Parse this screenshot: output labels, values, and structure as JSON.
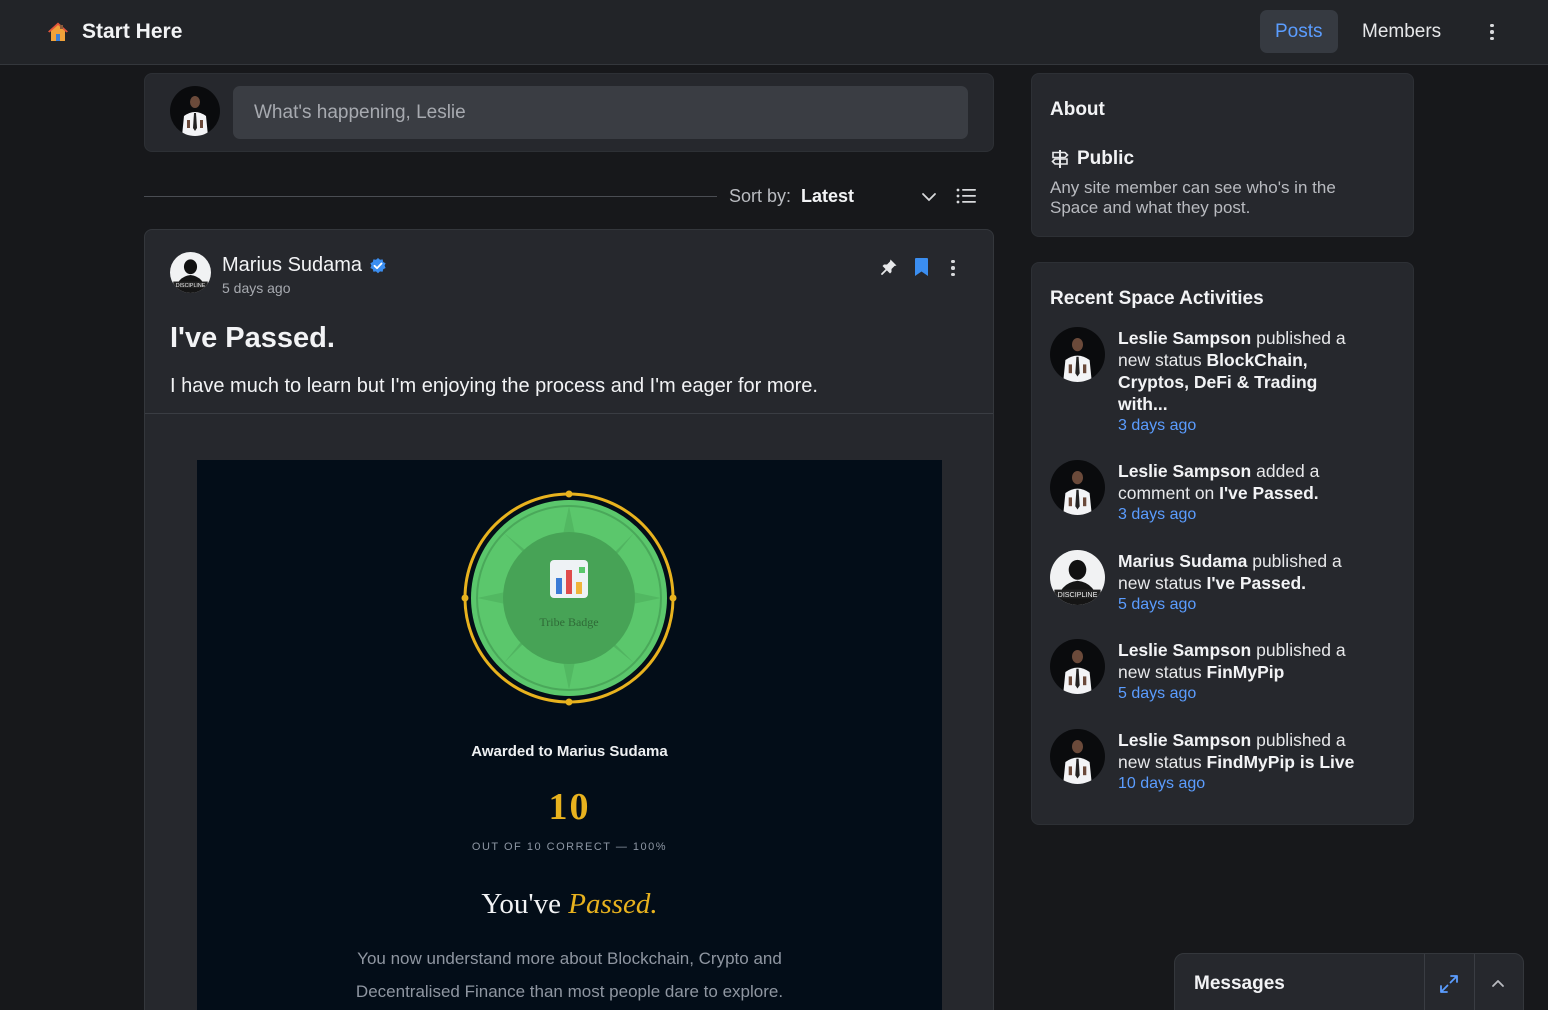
{
  "header": {
    "title": "Start Here",
    "tabs": [
      {
        "label": "Posts",
        "active": true
      },
      {
        "label": "Members",
        "active": false
      }
    ],
    "icons": {
      "brand": "house-icon",
      "menu": "more-vertical-icon"
    }
  },
  "composer": {
    "placeholder": "What's happening, Leslie"
  },
  "sort": {
    "label": "Sort by:",
    "value": "Latest"
  },
  "post": {
    "author": "Marius Sudama",
    "verified": true,
    "time": "5 days ago",
    "title": "I've Passed.",
    "body": "I have much to learn but I'm enjoying the process and I'm eager for more.",
    "certificate": {
      "badge_label": "Tribe Badge",
      "awarded": "Awarded to Marius Sudama",
      "score": "10",
      "score_sub": "OUT OF 10 CORRECT — 100%",
      "passed_prefix": "You've",
      "passed_word": "Passed.",
      "description_line1": "You now understand more about Blockchain, Crypto and",
      "description_line2": "Decentralised Finance than most people dare to explore."
    }
  },
  "about": {
    "title": "About",
    "visibility": "Public",
    "description": "Any site member can see who's in the Space and what they post."
  },
  "activities": {
    "title": "Recent Space Activities",
    "items": [
      {
        "actor": "Leslie Sampson",
        "action": " published a new status ",
        "target": "BlockChain, Cryptos, DeFi & Trading with...",
        "time": "3 days ago"
      },
      {
        "actor": "Leslie Sampson",
        "action": " added a comment on ",
        "target": "I've Passed.",
        "time": "3 days ago"
      },
      {
        "actor": "Marius Sudama",
        "action": " published a new status ",
        "target": "I've Passed.",
        "time": "5 days ago"
      },
      {
        "actor": "Leslie Sampson",
        "action": " published a new status ",
        "target": "FinMyPip",
        "time": "5 days ago"
      },
      {
        "actor": "Leslie Sampson",
        "action": " published a new status ",
        "target": "FindMyPip is Live",
        "time": "10 days ago"
      }
    ]
  },
  "messages": {
    "label": "Messages"
  },
  "colors": {
    "accent": "#5b9dff",
    "gold": "#e8b21e",
    "badge_green": "#5bc76c"
  }
}
